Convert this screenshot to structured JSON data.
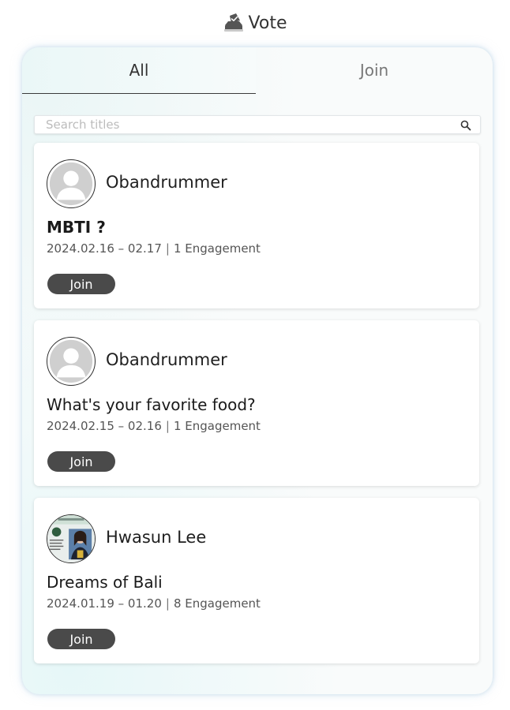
{
  "header": {
    "title": "Vote"
  },
  "tabs": [
    {
      "label": "All",
      "active": true
    },
    {
      "label": "Join",
      "active": false
    }
  ],
  "search": {
    "placeholder": "Search titles",
    "value": ""
  },
  "cards": [
    {
      "author": "Obandrummer",
      "avatar": "default-avatar",
      "title": "MBTI ?",
      "date_range": "2024.02.16 – 02.17",
      "engagement_count": "1",
      "engagement_label": "Engagement",
      "button_label": "Join"
    },
    {
      "author": "Obandrummer",
      "avatar": "default-avatar",
      "title": "What's your favorite food?",
      "date_range": "2024.02.15 – 02.16",
      "engagement_count": "1",
      "engagement_label": "Engagement",
      "button_label": "Join"
    },
    {
      "author": "Hwasun Lee",
      "avatar": "photo-avatar",
      "title": "Dreams of Bali",
      "date_range": "2024.01.19 – 01.20",
      "engagement_count": "8",
      "engagement_label": "Engagement",
      "button_label": "Join"
    }
  ],
  "colors": {
    "tab_underline": "#3a3a3a",
    "join_button": "#4a4a4a",
    "panel_glow": "#a0c3dc"
  }
}
